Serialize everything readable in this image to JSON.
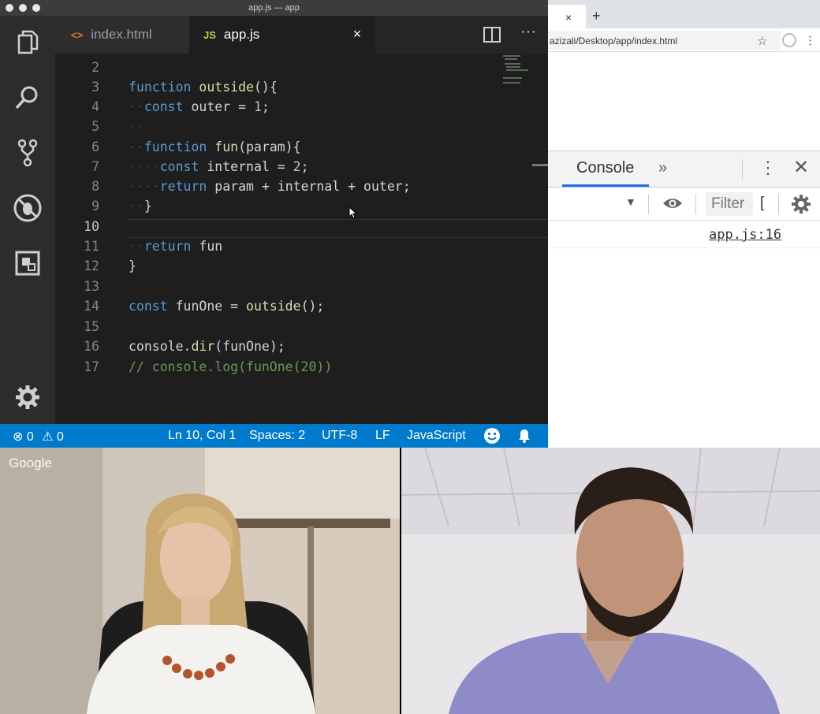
{
  "vscode": {
    "window_title": "app.js — app",
    "tabs": [
      {
        "icon": "<>",
        "label": "index.html",
        "active": false
      },
      {
        "icon": "JS",
        "label": "app.js",
        "active": true
      }
    ],
    "tab_close_glyph": "×",
    "more_glyph": "···",
    "editor": {
      "current_line": 10,
      "lines": [
        {
          "n": "2"
        },
        {
          "n": "3"
        },
        {
          "n": "4"
        },
        {
          "n": "5"
        },
        {
          "n": "6"
        },
        {
          "n": "7"
        },
        {
          "n": "8"
        },
        {
          "n": "9"
        },
        {
          "n": "10"
        },
        {
          "n": "11"
        },
        {
          "n": "12"
        },
        {
          "n": "13"
        },
        {
          "n": "14"
        },
        {
          "n": "15"
        },
        {
          "n": "16"
        },
        {
          "n": "17"
        }
      ],
      "code": {
        "l3_kw": "function",
        "l3_name": "outside",
        "l3_rest": "(){",
        "l4_kw": "const",
        "l4_rest": " outer = ",
        "l4_num": "1",
        "l4_end": ";",
        "l6_kw": "function",
        "l6_name": "fun",
        "l6_rest": "(param){",
        "l7_kw": "const",
        "l7_rest": " internal = ",
        "l7_num": "2",
        "l7_end": ";",
        "l8_kw": "return",
        "l8_rest": " param + internal + outer;",
        "l9": "}",
        "l11_kw": "return",
        "l11_rest": " fun",
        "l12": "}",
        "l14_kw": "const",
        "l14_rest": " funOne = ",
        "l14_fn": "outside",
        "l14_end": "();",
        "l16_a": "console",
        "l16_b": ".",
        "l16_fn": "dir",
        "l16_c": "(funOne);",
        "l17": "// console.log(funOne(20))"
      }
    },
    "status": {
      "errors": "0",
      "warnings": "0",
      "position": "Ln 10, Col 1",
      "spaces": "Spaces: 2",
      "encoding": "UTF-8",
      "eol": "LF",
      "language": "JavaScript"
    },
    "colors": {
      "statusbar": "#007acc",
      "keyword": "#569cd6",
      "function": "#dcdcaa",
      "number": "#b5cea8",
      "comment": "#6a9955"
    }
  },
  "chrome": {
    "tab_close_glyph": "×",
    "new_tab_glyph": "+",
    "url": "azizali/Desktop/app/index.html",
    "star_glyph": "☆",
    "menu_glyph": "⋮",
    "devtools": {
      "tab_label": "Console",
      "more_tabs_glyph": "»",
      "kebab_glyph": "⋮",
      "close_glyph": "✕",
      "dropdown_glyph": "▼",
      "filter_placeholder": "Filter",
      "filter_clip": "[",
      "log_source": "app.js:16"
    }
  },
  "video": {
    "watermark": "Google"
  }
}
